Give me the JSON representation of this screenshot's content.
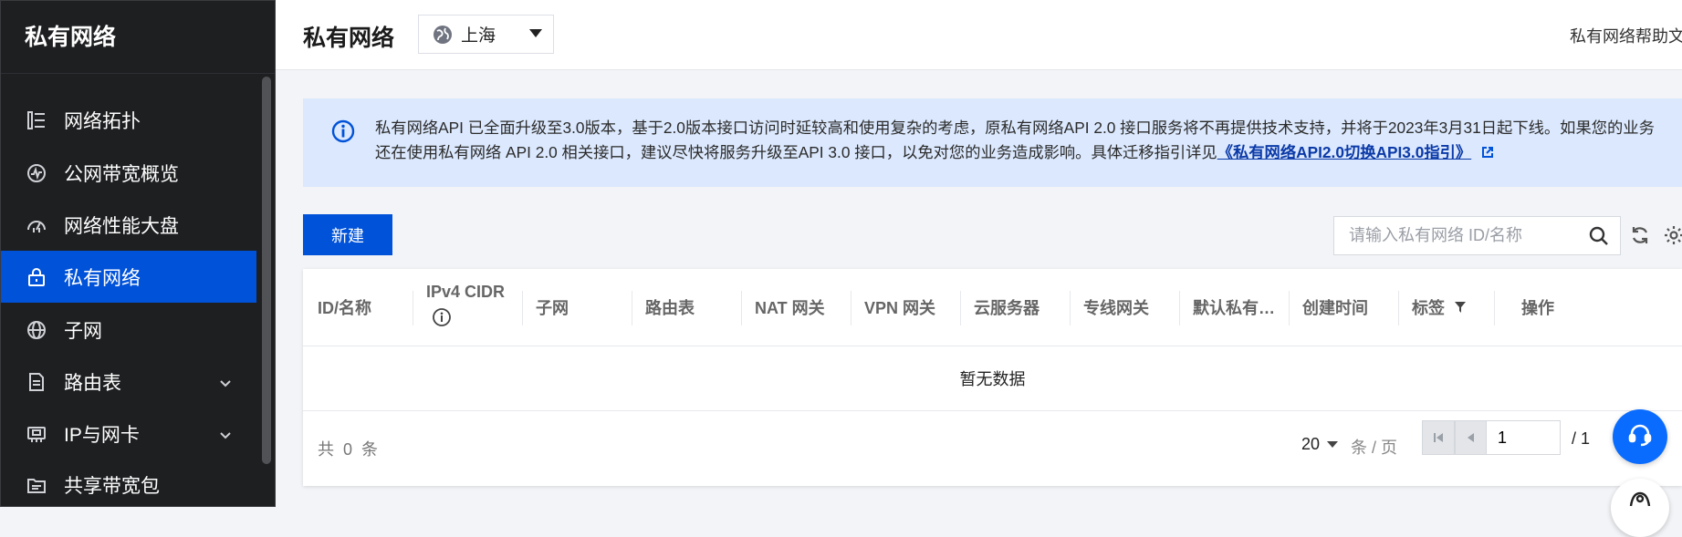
{
  "sidebar": {
    "title": "私有网络",
    "items": [
      {
        "label": "网络拓扑",
        "icon": "topology-icon"
      },
      {
        "label": "公网带宽概览",
        "icon": "bandwidth-icon"
      },
      {
        "label": "网络性能大盘",
        "icon": "performance-icon"
      },
      {
        "label": "私有网络",
        "icon": "vpc-lock-icon",
        "active": true
      },
      {
        "label": "子网",
        "icon": "globe-icon"
      },
      {
        "label": "路由表",
        "icon": "route-table-icon",
        "expandable": true
      },
      {
        "label": "IP与网卡",
        "icon": "ip-nic-icon",
        "expandable": true
      },
      {
        "label": "共享带宽包",
        "icon": "shared-bandwidth-icon"
      }
    ]
  },
  "header": {
    "title": "私有网络",
    "region": "上海",
    "help_link": "私有网络帮助文"
  },
  "alert": {
    "text": "私有网络API 已全面升级至3.0版本，基于2.0版本接口访问时延较高和使用复杂的考虑，原私有网络API 2.0 接口服务将不再提供技术支持，并将于2023年3月31日起下线。如果您的业务还在使用私有网络 API 2.0 相关接口，建议尽快将服务升级至API 3.0 接口，以免对您的业务造成影响。具体迁移指引详见",
    "link": "《私有网络API2.0切换API3.0指引》"
  },
  "toolbar": {
    "new_label": "新建",
    "search_placeholder": "请输入私有网络 ID/名称"
  },
  "table": {
    "columns": [
      "ID/名称",
      "IPv4 CIDR",
      "子网",
      "路由表",
      "NAT 网关",
      "VPN 网关",
      "云服务器",
      "专线网关",
      "默认私有…",
      "创建时间",
      "标签",
      "操作"
    ],
    "empty_text": "暂无数据"
  },
  "pagination": {
    "total_prefix": "共",
    "total": "0",
    "total_suffix": "条",
    "page_size": "20",
    "per_page": "条 / 页",
    "current_page": "1",
    "total_pages": "/ 1"
  },
  "colors": {
    "accent": "#0052d9",
    "sidebar_bg": "#1e1f21",
    "alert_bg": "#dbe8fd"
  }
}
